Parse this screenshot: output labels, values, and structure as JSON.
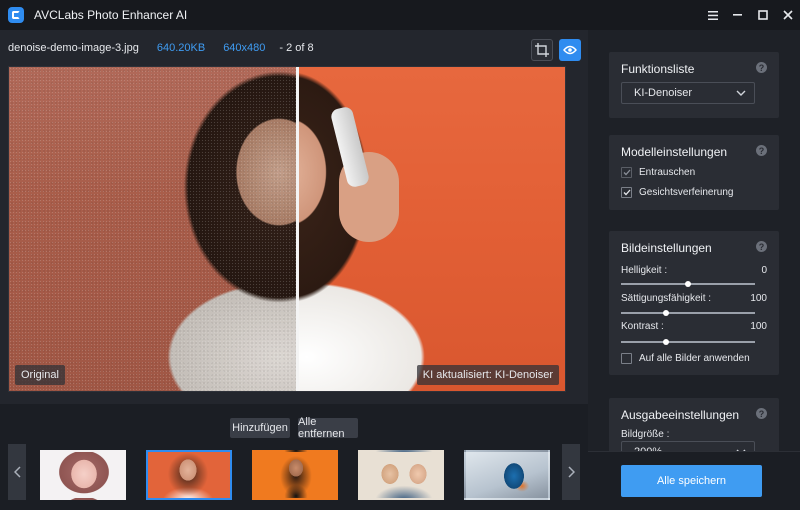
{
  "app": {
    "title": "AVCLabs Photo Enhancer AI"
  },
  "window": {
    "menu_icon": "menu-icon",
    "minimize_icon": "minimize-icon",
    "maximize_icon": "maximize-icon",
    "close_icon": "close-icon"
  },
  "info": {
    "filename": "denoise-demo-image-3.jpg",
    "filesize": "640.20KB",
    "resolution": "640x480",
    "count": "- 2 of 8"
  },
  "preview": {
    "original_label": "Original",
    "ai_label": "KI aktualisiert: KI-Denoiser"
  },
  "strip": {
    "add_label": "Hinzufügen",
    "remove_label": "Alle entfernen",
    "active_index": 1,
    "thumbnails": [
      "thumb-1",
      "thumb-2",
      "thumb-3",
      "thumb-4",
      "thumb-5"
    ]
  },
  "panel": {
    "function_list": {
      "title": "Funktionsliste",
      "selected": "KI-Denoiser"
    },
    "model_settings": {
      "title": "Modelleinstellungen",
      "options": [
        {
          "label": "Entrauschen",
          "checked": true,
          "disabled": true
        },
        {
          "label": "Gesichtsverfeinerung",
          "checked": true,
          "disabled": false
        }
      ]
    },
    "image_settings": {
      "title": "Bildeinstellungen",
      "sliders": [
        {
          "label": "Helligkeit :",
          "value": "0"
        },
        {
          "label": "Sättigungsfähigkeit :",
          "value": "100"
        },
        {
          "label": "Kontrast :",
          "value": "100"
        }
      ],
      "apply_all": {
        "label": "Auf alle Bilder anwenden",
        "checked": false
      }
    },
    "output_settings": {
      "title": "Ausgabeeinstellungen",
      "size_label": "Bildgröße :",
      "size_value": "200%"
    },
    "save_label": "Alle speichern"
  },
  "colors": {
    "accent": "#2f8cf0",
    "background": "#1b1e24"
  }
}
